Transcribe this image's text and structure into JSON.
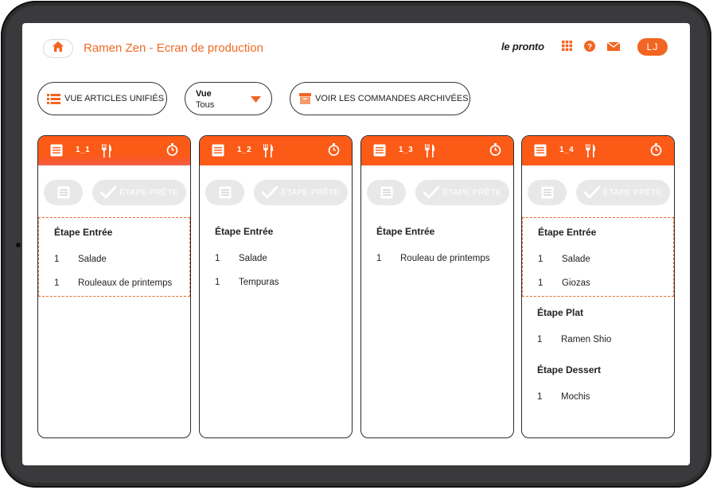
{
  "header": {
    "title": "Ramen Zen - Ecran de production",
    "brand": "le pronto",
    "user_initials": "LJ",
    "home_icon": "home-icon",
    "icons": [
      "grid-icon",
      "help-icon",
      "mail-icon"
    ]
  },
  "toolbar": {
    "unified_label": "VUE ARTICLES UNIFIÉS",
    "view_label": "Vue",
    "view_value": "Tous",
    "archived_label": "VOIR LES COMMANDES ARCHIVÉES"
  },
  "colors": {
    "accent": "#f26522",
    "grey_button": "#e8e8e8"
  },
  "card_common": {
    "ready_label": "ÉTAPE PRÊTE"
  },
  "orders": [
    {
      "number": "1_1",
      "stages": [
        {
          "title": "Étape Entrée",
          "selected": true,
          "items": [
            {
              "qty": "1",
              "name": "Salade"
            },
            {
              "qty": "1",
              "name": "Rouleaux de printemps"
            }
          ]
        }
      ]
    },
    {
      "number": "1_2",
      "stages": [
        {
          "title": "Étape Entrée",
          "selected": false,
          "items": [
            {
              "qty": "1",
              "name": "Salade"
            },
            {
              "qty": "1",
              "name": "Tempuras"
            }
          ]
        }
      ]
    },
    {
      "number": "1_3",
      "stages": [
        {
          "title": "Étape Entrée",
          "selected": false,
          "items": [
            {
              "qty": "1",
              "name": "Rouleau de printemps"
            }
          ]
        }
      ]
    },
    {
      "number": "1_4",
      "stages": [
        {
          "title": "Étape Entrée",
          "selected": true,
          "items": [
            {
              "qty": "1",
              "name": "Salade"
            },
            {
              "qty": "1",
              "name": "Giozas"
            }
          ]
        },
        {
          "title": "Étape Plat",
          "selected": false,
          "items": [
            {
              "qty": "1",
              "name": "Ramen Shio"
            }
          ]
        },
        {
          "title": "Étape Dessert",
          "selected": false,
          "items": [
            {
              "qty": "1",
              "name": "Mochis"
            }
          ]
        }
      ]
    }
  ]
}
